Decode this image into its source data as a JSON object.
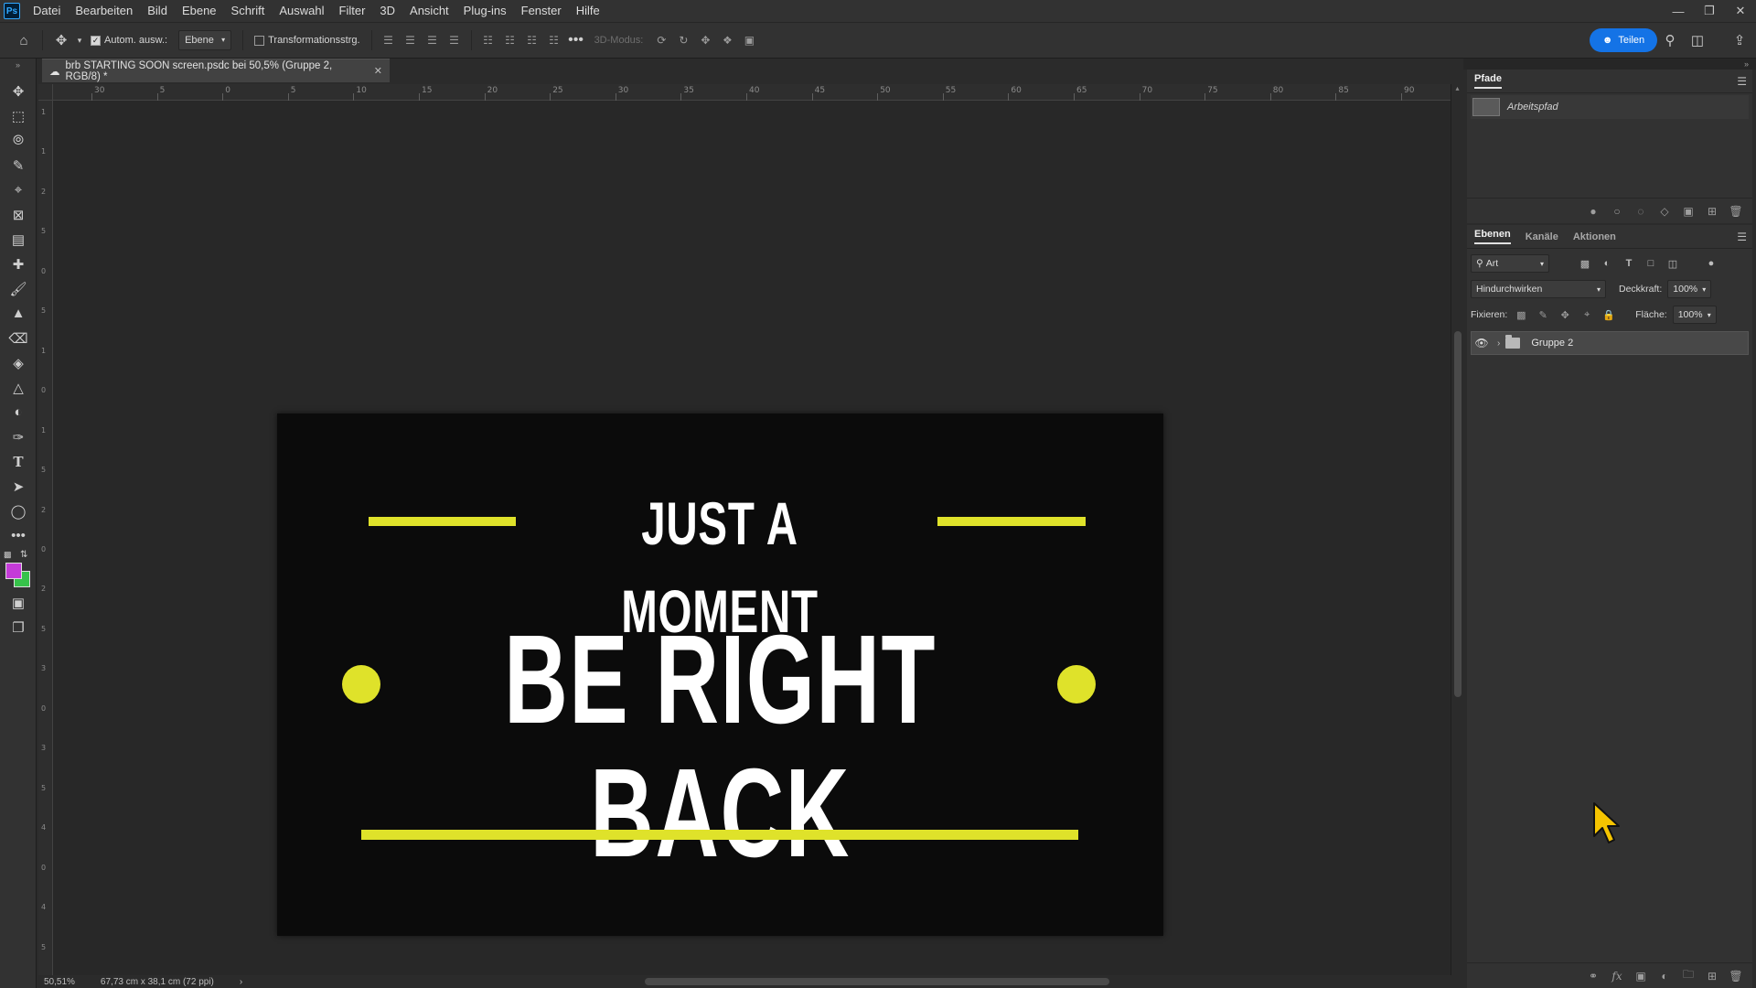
{
  "menubar": {
    "app_icon": "Ps",
    "items": [
      "Datei",
      "Bearbeiten",
      "Bild",
      "Ebene",
      "Schrift",
      "Auswahl",
      "Filter",
      "3D",
      "Ansicht",
      "Plug-ins",
      "Fenster",
      "Hilfe"
    ]
  },
  "options": {
    "auto_select_label": "Autom. ausw.:",
    "auto_select_checked": true,
    "target_value": "Ebene",
    "transform_label": "Transformationsstrg.",
    "transform_checked": false,
    "mode3d_label": "3D-Modus:",
    "share_label": "Teilen"
  },
  "document": {
    "tab_title": "brb STARTING SOON screen.psdc bei 50,5% (Gruppe 2, RGB/8) *",
    "zoom": "50,51%",
    "size_info": "67,73 cm x 38,1 cm (72 ppi)"
  },
  "ruler": {
    "top_labels": [
      "30",
      "5",
      "0",
      "5",
      "10",
      "15",
      "20",
      "25",
      "30",
      "35",
      "40",
      "45",
      "50",
      "55",
      "60",
      "65",
      "70",
      "75",
      "80",
      "85",
      "90"
    ],
    "left_labels": [
      "1",
      "1",
      "2",
      "5",
      "0",
      "5",
      "1",
      "0",
      "1",
      "5",
      "2",
      "0",
      "2",
      "5",
      "3",
      "0",
      "3",
      "5",
      "4",
      "0",
      "4",
      "5"
    ]
  },
  "artboard": {
    "headline_small": "JUST A MOMENT",
    "headline_large": "BE RIGHT BACK",
    "accent_color": "#dfe22a",
    "background_color": "#0b0b0b"
  },
  "paths_panel": {
    "title": "Pfade",
    "items": [
      {
        "name": "Arbeitspfad"
      }
    ]
  },
  "layers_panel": {
    "tabs": [
      "Ebenen",
      "Kanäle",
      "Aktionen"
    ],
    "active_tab": "Ebenen",
    "filter_kind": "Art",
    "blend_mode": "Hindurchwirken",
    "opacity_label": "Deckkraft:",
    "opacity_value": "100%",
    "lock_label": "Fixieren:",
    "fill_label": "Fläche:",
    "fill_value": "100%",
    "layers": [
      {
        "name": "Gruppe 2",
        "type": "group",
        "visible": true
      }
    ]
  },
  "colors": {
    "foreground": "#c43bd8",
    "background": "#36c24a",
    "share_button": "#1473e6"
  }
}
